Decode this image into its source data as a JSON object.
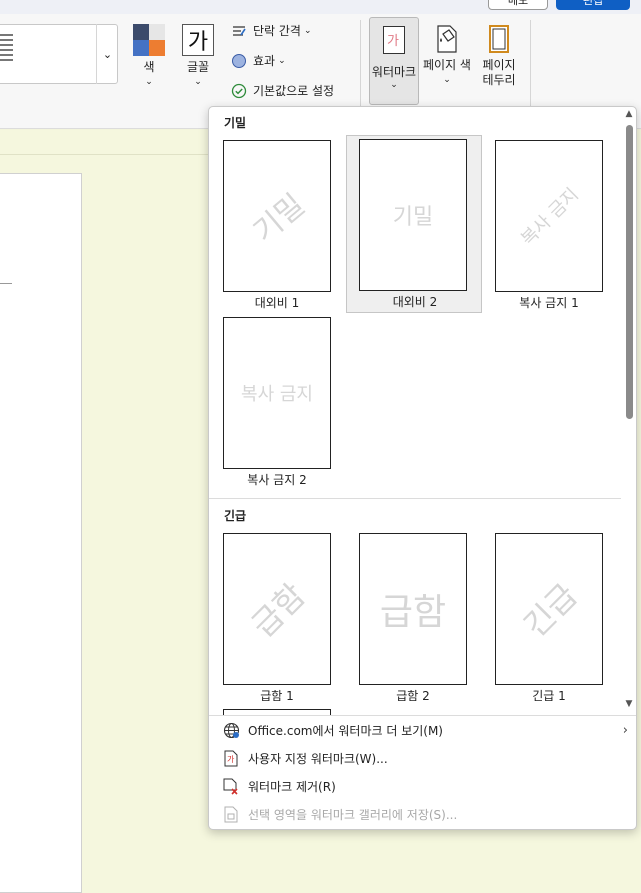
{
  "topbar": {
    "memo_label": "메모",
    "share_label": "편집"
  },
  "ribbon": {
    "colors_label": "색",
    "fonts_label": "글꼴",
    "fonts_glyph": "가",
    "paragraph_spacing_label": "단락 간격",
    "effects_label": "효과",
    "set_default_label": "기본값으로 설정",
    "watermark_label": "워터마크",
    "watermark_glyph": "가",
    "page_color_label": "페이지 색",
    "page_borders_label_1": "페이지",
    "page_borders_label_2": "테두리",
    "chevron": "⌄"
  },
  "watermark_panel": {
    "section_confidential": "기밀",
    "section_urgent": "긴급",
    "confidential_items": [
      {
        "caption": "대외비 1",
        "text": "기밀"
      },
      {
        "caption": "대외비 2",
        "text": "기밀"
      },
      {
        "caption": "복사 금지 1",
        "text": "복사 금지"
      },
      {
        "caption": "복사 금지 2",
        "text": "복사 금지"
      }
    ],
    "urgent_items": [
      {
        "caption": "급함 1",
        "text": "급함"
      },
      {
        "caption": "급함 2",
        "text": "급함"
      },
      {
        "caption": "긴급 1",
        "text": "긴급"
      }
    ],
    "selected_caption": "대외비 2"
  },
  "menu": {
    "more_watermarks": "Office.com에서 워터마크 더 보기(M)",
    "custom_watermark": "사용자 지정 워터마크(W)...",
    "remove_watermark": "워터마크 제거(R)",
    "save_selection": "선택 영역을 워터마크 갤러리에 저장(S)..."
  },
  "colors": {
    "accent_blue": "#0f5fc4",
    "watermark_gray": "#d6d6d6",
    "remove_red": "#d0312d"
  }
}
